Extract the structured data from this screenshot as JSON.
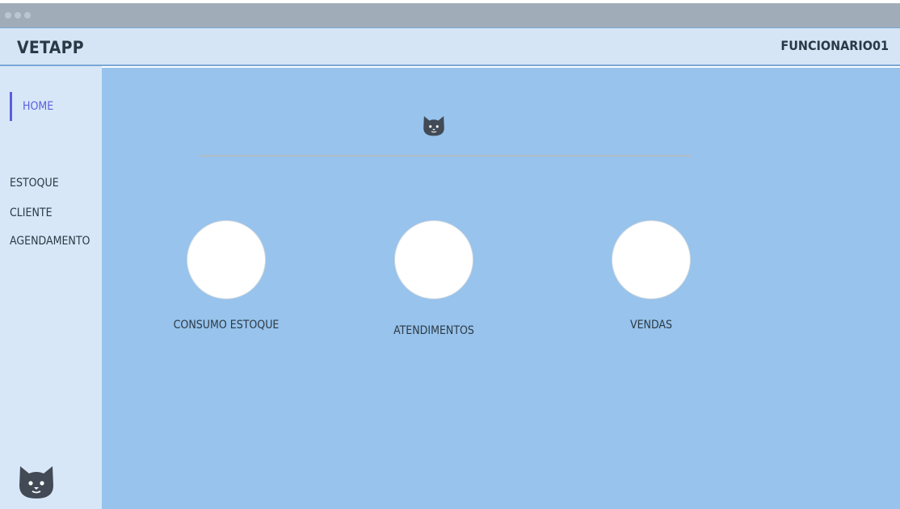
{
  "app": {
    "brand": "VETAPP",
    "user": "FUNCIONARIO01"
  },
  "sidebar": {
    "items": [
      {
        "label": "HOME",
        "active": true
      },
      {
        "label": "ESTOQUE"
      },
      {
        "label": "CLIENTE"
      },
      {
        "label": "AGENDAMENTO"
      }
    ],
    "logo_icon": "cat-icon"
  },
  "main": {
    "header_icon": "cat-icon",
    "tiles": [
      {
        "label": "CONSUMO ESTOQUE"
      },
      {
        "label": "ATENDIMENTOS"
      },
      {
        "label": "VENDAS"
      }
    ]
  },
  "colors": {
    "accent": "#5a5fe0",
    "main_bg": "#97c3ec",
    "sidebar_bg": "#d7e7f7",
    "header_bg": "#d5e5f5",
    "cat": "#414a55"
  }
}
